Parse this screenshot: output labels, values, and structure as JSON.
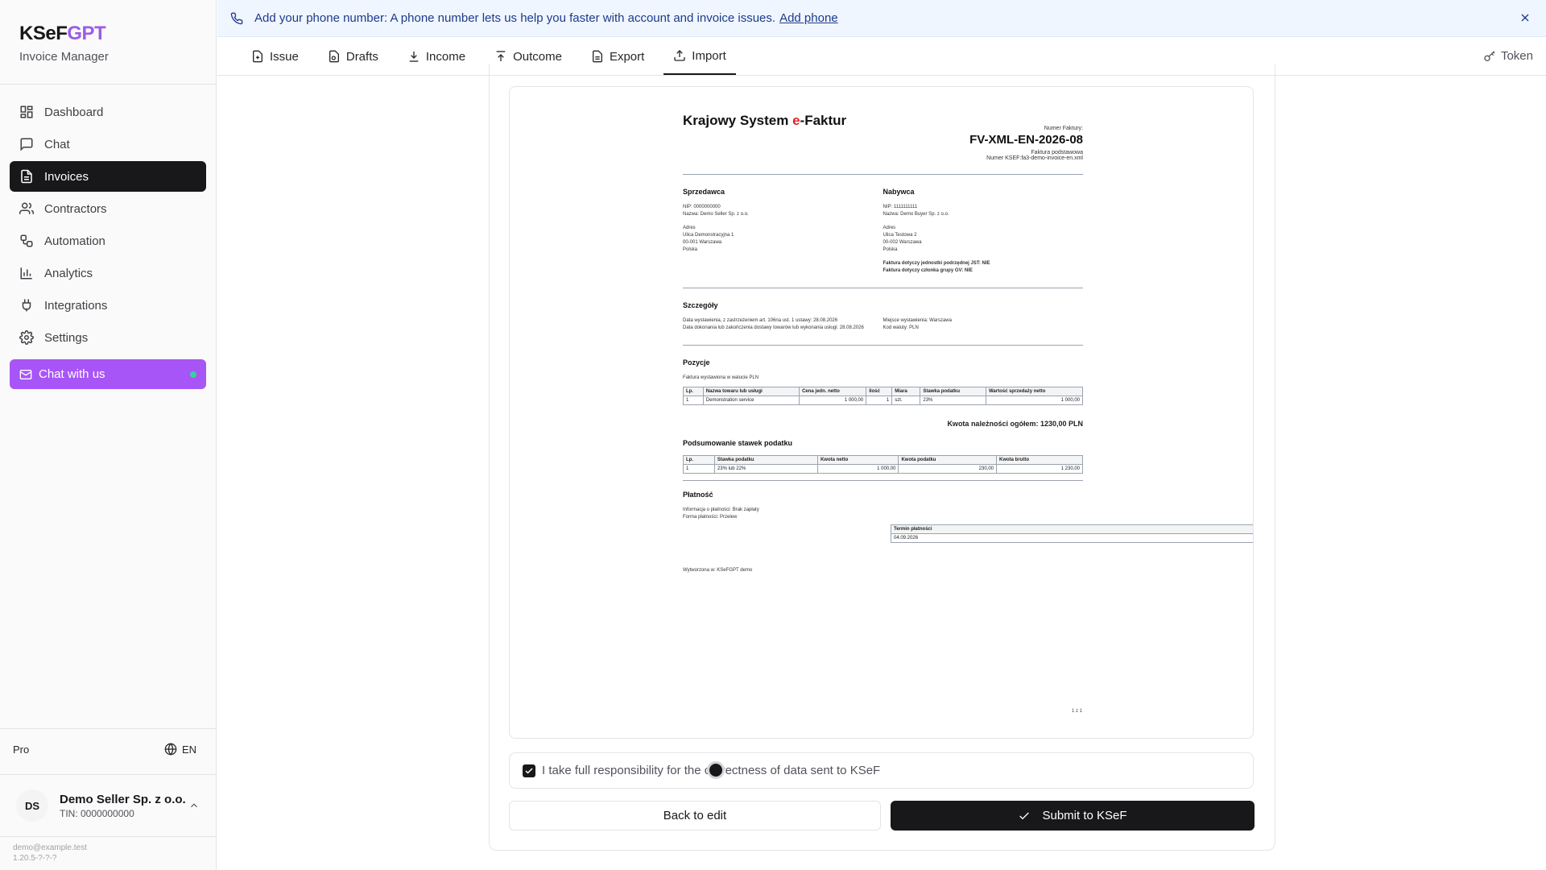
{
  "brand": {
    "title_main": "KSeF",
    "title_accent": "GPT",
    "subtitle": "Invoice Manager"
  },
  "sidebar": {
    "items": [
      {
        "label": "Dashboard",
        "icon": "dashboard-icon"
      },
      {
        "label": "Chat",
        "icon": "chat-icon"
      },
      {
        "label": "Invoices",
        "icon": "invoice-icon",
        "active": true
      },
      {
        "label": "Contractors",
        "icon": "users-icon"
      },
      {
        "label": "Automation",
        "icon": "workflow-icon"
      },
      {
        "label": "Analytics",
        "icon": "bar-chart-icon"
      },
      {
        "label": "Integrations",
        "icon": "plug-icon"
      },
      {
        "label": "Settings",
        "icon": "gear-icon"
      }
    ],
    "chat_button": "Chat with us",
    "plan": "Pro",
    "language": "EN",
    "account": {
      "initials": "DS",
      "name": "Demo Seller Sp. z o.o.",
      "tin": "TIN: 0000000000"
    },
    "footer_email": "demo@example.test",
    "footer_version": "1.20.5-?-?-?"
  },
  "banner": {
    "text": "Add your phone number: A phone number lets us help you faster with account and invoice issues.",
    "link": "Add phone"
  },
  "tabs": [
    {
      "label": "Issue",
      "icon": "file-plus-icon"
    },
    {
      "label": "Drafts",
      "icon": "drafts-icon"
    },
    {
      "label": "Income",
      "icon": "download-icon"
    },
    {
      "label": "Outcome",
      "icon": "upload-icon"
    },
    {
      "label": "Export",
      "icon": "file-text-icon"
    },
    {
      "label": "Import",
      "icon": "upload-icon",
      "active": true
    }
  ],
  "token_label": "Token",
  "invoice": {
    "header_pre": "Krajowy System ",
    "header_e": "e",
    "header_post": "-Faktur",
    "number_label": "Numer Faktury:",
    "number": "FV-XML-EN-2026-08",
    "kind": "Faktura podstawowa",
    "ksef_number": "Numer KSEF:fa3-demo-invoice-en.xml",
    "seller": {
      "heading": "Sprzedawca",
      "nip": "NIP: 0000000000",
      "name": "Nazwa: Demo Seller Sp. z o.o.",
      "addr_label": "Adres",
      "addr1": "Ulica Demonstracyjna 1",
      "addr2": "00-001 Warszawa",
      "addr3": "Polska"
    },
    "buyer": {
      "heading": "Nabywca",
      "nip": "NIP: 1111111111",
      "name": "Nazwa: Demo Buyer Sp. z o.o.",
      "addr_label": "Adres",
      "addr1": "Ulica Testowa 2",
      "addr2": "00-002 Warszawa",
      "addr3": "Polska",
      "jst": "Faktura dotyczy jednostki podrzędnej JST: NIE",
      "gv": "Faktura dotyczy członka grupy GV: NIE"
    },
    "details": {
      "heading": "Szczegóły",
      "issue_date": "Data wystawienia, z zastrzeżeniem art. 106na ust. 1 ustawy: 28.08.2026",
      "delivery_date": "Data dokonania lub zakończenia dostawy towarów lub wykonania usługi: 28.08.2026",
      "place": "Miejsce wystawienia: Warszawa",
      "currency": "Kod waluty: PLN"
    },
    "positions": {
      "heading": "Pozycje",
      "note": "Faktura wystawiona w walucie PLN",
      "columns": [
        "Lp.",
        "Nazwa towaru lub usługi",
        "Cena jedn. netto",
        "Ilość",
        "Miara",
        "Stawka podatku",
        "Wartość sprzedaży netto"
      ],
      "rows": [
        [
          "1",
          "Demonstration service",
          "1 000,00",
          "1",
          "szt.",
          "23%",
          "1 000,00"
        ]
      ]
    },
    "total": "Kwota należności ogółem: 1230,00 PLN",
    "tax_summary": {
      "heading": "Podsumowanie stawek podatku",
      "columns": [
        "Lp.",
        "Stawka podatku",
        "Kwota netto",
        "Kwota podatku",
        "Kwota brutto"
      ],
      "rows": [
        [
          "1",
          "23% lub 22%",
          "1 000,00",
          "230,00",
          "1 230,00"
        ]
      ]
    },
    "payment": {
      "heading": "Płatność",
      "info": "Informacja o płatności: Brak zapłaty",
      "form": "Forma płatności: Przelew",
      "due_label": "Termin płatności",
      "due_date": "04.09.2026"
    },
    "created_by": "Wytworzona w: KSeFGPT demo",
    "page_num": "1 z 1"
  },
  "confirm_text": "I take full responsibility for the correctness of data sent to KSeF",
  "back_button": "Back to edit",
  "submit_button": "Submit to KSeF"
}
